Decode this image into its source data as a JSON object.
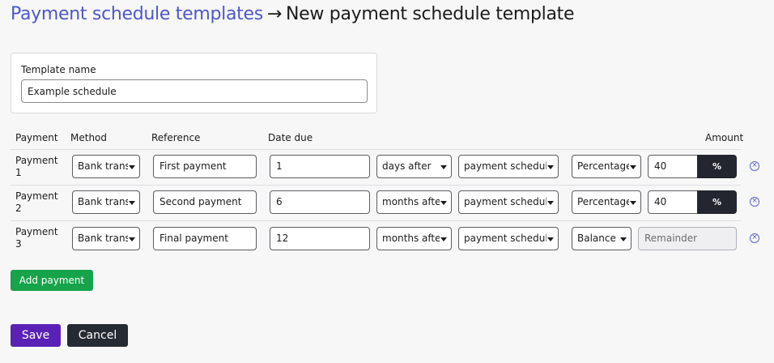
{
  "breadcrumb": {
    "parent": "Payment schedule templates",
    "separator": "→",
    "current": "New payment schedule template"
  },
  "template": {
    "name_label": "Template name",
    "name_value": "Example schedule"
  },
  "columns": {
    "payment": "Payment",
    "method": "Method",
    "reference": "Reference",
    "date_due": "Date due",
    "amount": "Amount"
  },
  "rows": [
    {
      "label": "Payment 1",
      "method": "Bank transfer",
      "reference": "First payment",
      "offset": "1",
      "unit": "days after",
      "anchor": "payment schedule created",
      "amount_type": "Percentage",
      "amount_value": "40",
      "amount_unit": "%"
    },
    {
      "label": "Payment 2",
      "method": "Bank transfer",
      "reference": "Second payment",
      "offset": "6",
      "unit": "months after",
      "anchor": "payment schedule created",
      "amount_type": "Percentage",
      "amount_value": "40",
      "amount_unit": "%"
    },
    {
      "label": "Payment 3",
      "method": "Bank transfer",
      "reference": "Final payment",
      "offset": "12",
      "unit": "months after",
      "anchor": "payment schedule created",
      "amount_type": "Balance",
      "amount_placeholder": "Remainder"
    }
  ],
  "remove_icon": "circle-x-icon",
  "buttons": {
    "add_payment": "Add payment",
    "save": "Save",
    "cancel": "Cancel"
  },
  "colors": {
    "link": "#4e57c9",
    "add_button": "#16a34a",
    "save_button": "#5b21b6",
    "dark_button": "#262a33"
  }
}
